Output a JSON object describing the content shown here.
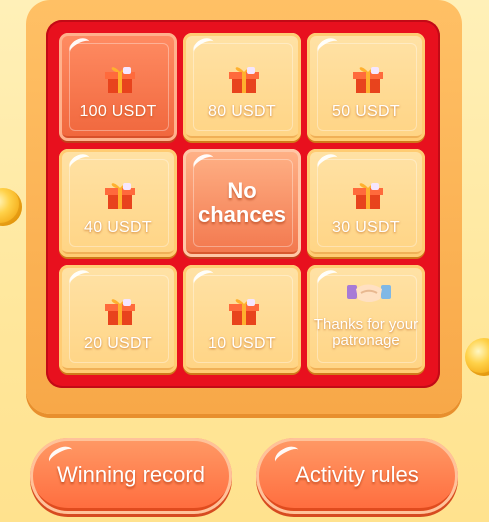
{
  "prizes": [
    {
      "label": "100 USDT",
      "icon": "gift-box-icon",
      "highlight": true
    },
    {
      "label": "80 USDT",
      "icon": "gift-box-icon"
    },
    {
      "label": "50 USDT",
      "icon": "gift-box-icon"
    },
    {
      "label": "40 USDT",
      "icon": "gift-box-icon"
    },
    {
      "label": "30 USDT",
      "icon": "gift-box-icon"
    },
    {
      "label": "20 USDT",
      "icon": "gift-box-icon"
    },
    {
      "label": "10 USDT",
      "icon": "gift-box-icon"
    },
    {
      "label": "Thanks for your patronage",
      "icon": "handshake-icon"
    }
  ],
  "center": {
    "label_line1": "No",
    "label_line2": "chances"
  },
  "buttons": {
    "winning_record": "Winning record",
    "activity_rules": "Activity rules"
  },
  "colors": {
    "frame_red": "#e8101e",
    "accent_orange": "#ff6a3c",
    "tile_gold": "#ffd484"
  }
}
